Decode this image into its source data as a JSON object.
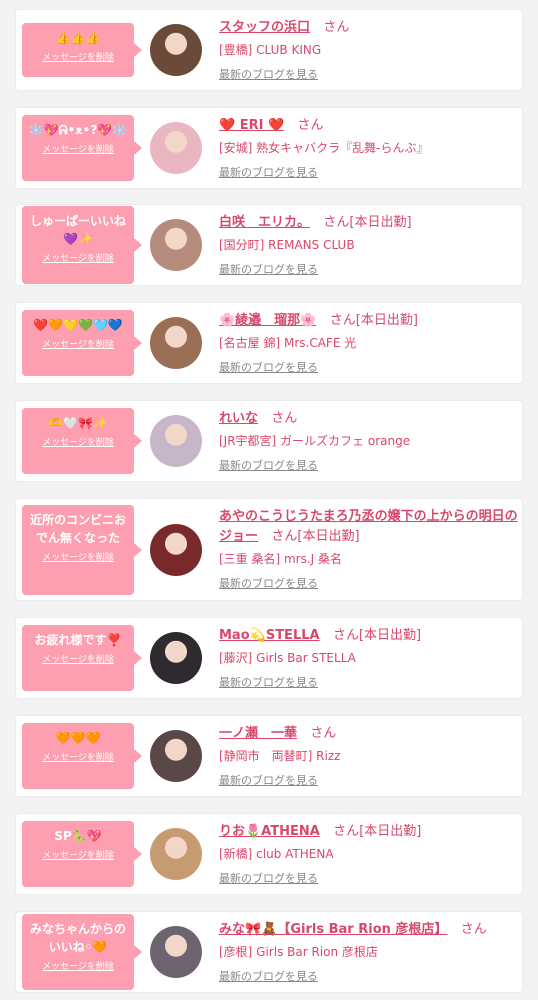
{
  "delete_label": "メッセージを削除",
  "blog_label": "最新のブログを見る",
  "san": "さん",
  "colors": {
    "accent": "#d9486b",
    "bubble": "#fd9fb0",
    "link_gray": "#888888"
  },
  "items": [
    {
      "message": "👍👍👍",
      "name": "スタッフの浜口",
      "tag": "",
      "shop": "[豊橋] CLUB KING",
      "avatar_color": "#6b4a3a"
    },
    {
      "message": "❄️💖ᕱ•ᴥ•?💖❄️",
      "name": "❤️ ERI ❤️",
      "tag": "",
      "shop": "[安城] 熟女キャバクラ『乱舞-らんぶ』",
      "avatar_color": "#e9b6c2"
    },
    {
      "message": "しゅーぱーいいね\n💜✨",
      "name": "白咲　エリカ。",
      "tag": "[本日出勤]",
      "shop": "[国分町] REMANS CLUB",
      "avatar_color": "#b58c7c"
    },
    {
      "message": "❤️🧡💛💚🩵💙",
      "name": "🌸綾邉　瑠那🌸",
      "tag": "[本日出勤]",
      "shop": "[名古屋 錦] Mrs.CAFE 光",
      "avatar_color": "#9a6d55"
    },
    {
      "message": "🫶🤍🎀✨",
      "name": "れいな",
      "tag": "",
      "shop": "[JR宇都宮] ガールズカフェ orange",
      "avatar_color": "#c6b6c8"
    },
    {
      "message": "近所のコンビニお\nでん無くなった",
      "name": "あやのこうじうたまろ乃丞の嬢下の上からの明日のジョー",
      "tag": "[本日出勤]",
      "shop": "[三重 桑名] mrs.J 桑名",
      "avatar_color": "#7a2a2a"
    },
    {
      "message": "お疲れ様です❣️",
      "name": "Mao💫STELLA",
      "tag": "[本日出勤]",
      "shop": "[藤沢] Girls Bar STELLA",
      "avatar_color": "#2e2a30"
    },
    {
      "message": "🧡🧡🧡",
      "name": "一ノ瀬　一華",
      "tag": "",
      "shop": "[静岡市　両替町] Rizz",
      "avatar_color": "#5a4848"
    },
    {
      "message": "SP🐍💖",
      "name": "りお🌷ATHENA",
      "tag": "[本日出勤]",
      "shop": "[新橋] club ATHENA",
      "avatar_color": "#c79b72"
    },
    {
      "message": "みなちゃんからの\nいいね◦🧡",
      "name": "みな🎀🧸【Girls Bar Rion 彦根店】",
      "tag": "",
      "shop": "[彦根] Girls Bar Rion 彦根店",
      "avatar_color": "#6e6470"
    }
  ]
}
